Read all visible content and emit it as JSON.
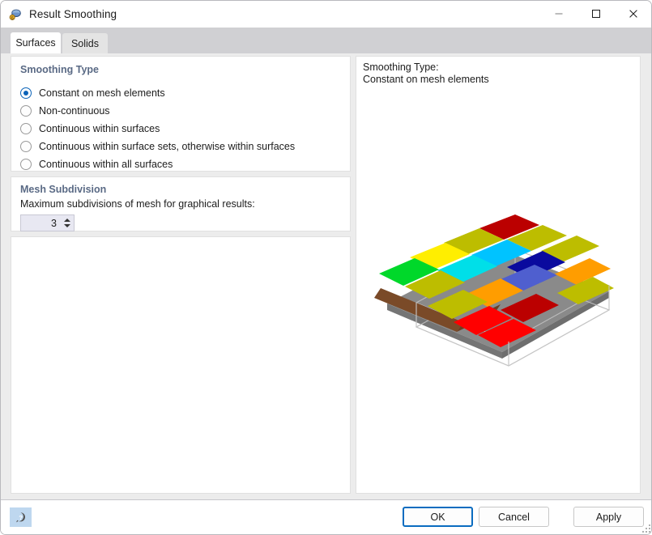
{
  "window": {
    "title": "Result Smoothing",
    "icon": "result-smoothing-icon",
    "controls": {
      "minimize": "minimize-icon",
      "maximize": "maximize-icon",
      "close": "close-icon"
    }
  },
  "tabs": [
    {
      "label": "Surfaces",
      "active": true
    },
    {
      "label": "Solids",
      "active": false
    }
  ],
  "smoothing_group": {
    "title": "Smoothing Type",
    "options": [
      {
        "label": "Constant on mesh elements",
        "checked": true
      },
      {
        "label": "Non-continuous",
        "checked": false
      },
      {
        "label": "Continuous within surfaces",
        "checked": false
      },
      {
        "label": "Continuous within surface sets, otherwise within surfaces",
        "checked": false
      },
      {
        "label": "Continuous within all surfaces",
        "checked": false
      }
    ]
  },
  "mesh_group": {
    "title": "Mesh Subdivision",
    "description": "Maximum subdivisions of mesh for graphical results:",
    "value": "3"
  },
  "preview": {
    "label": "Smoothing Type:\nConstant on mesh elements"
  },
  "footer": {
    "help": "?",
    "ok": "OK",
    "cancel": "Cancel",
    "apply": "Apply"
  },
  "colors": {
    "accent": "#0a6cc0",
    "group_title": "#5a6a85",
    "tabstrip_bg": "#d0d0d3",
    "body_bg": "#ececec",
    "help_bg": "#bed7ef"
  },
  "preview_mesh": {
    "description": "3D isometric plate of colored mesh elements over a gray slab with wireframe box outline",
    "element_colors": [
      [
        "#00d82a",
        "#ffee00",
        "#bdbd00",
        "#bb0000",
        "#bdbd00",
        "#bdbd00"
      ],
      [
        "#00d82a",
        "#bdbd00",
        "#00c3ff",
        "#00dfe8",
        "#0a0a9e",
        "#bdbd00"
      ],
      [
        "#7a4a28",
        "#bdbd00",
        "#00dfe8",
        "#4f5fcf",
        "#8a8a8a",
        "#ff9d00"
      ],
      [
        "#7a4a28",
        "#bdbd00",
        "#ff9d00",
        "#ff0000",
        "#bdbd00",
        "#ff9d00"
      ],
      [
        "#7a4a28",
        "#ff0000",
        "#ff0000",
        "#bb0000",
        "#bb0000",
        "#bdbd00"
      ]
    ],
    "slab_color": "#8a8a8a",
    "wireframe_color": "#bcbcbc"
  }
}
